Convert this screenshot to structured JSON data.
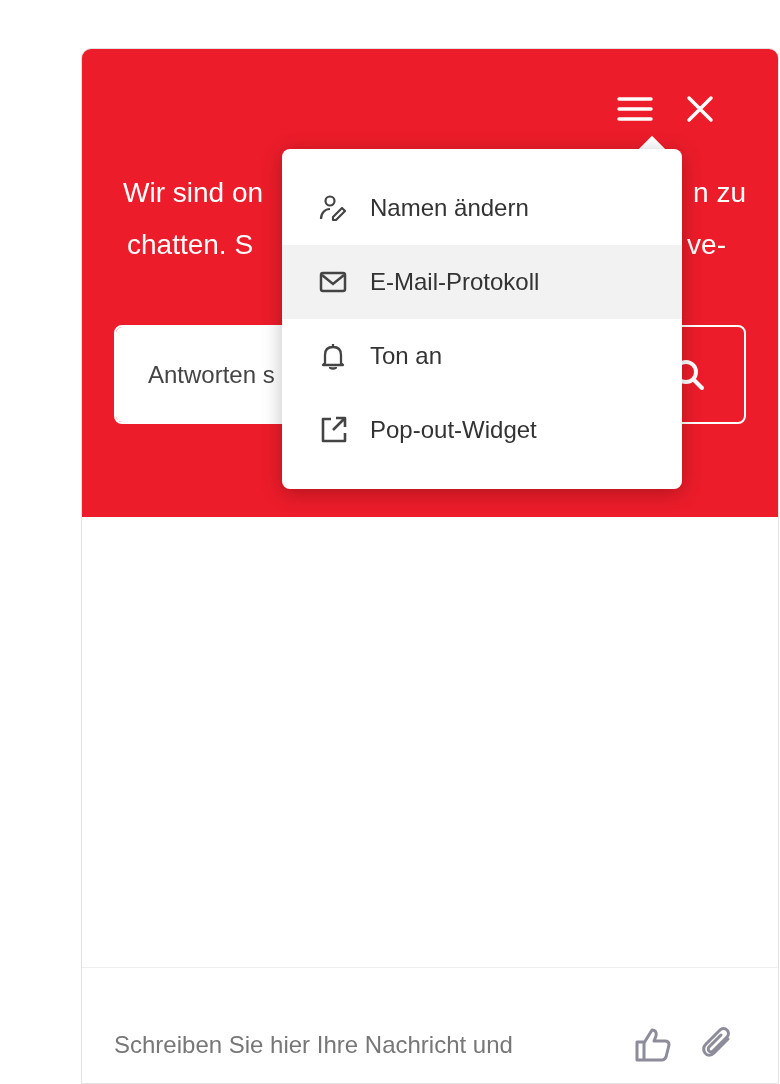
{
  "header": {
    "greeting_lines": [
      {
        "left": "Wir sind on",
        "right": "n zu"
      },
      {
        "left": "chatten. S",
        "right": "ve-"
      }
    ],
    "search": {
      "placeholder": "Antworten s"
    }
  },
  "menu": {
    "open": true,
    "items": [
      {
        "kind": "rename",
        "label": "Namen ändern",
        "selected": false
      },
      {
        "kind": "email",
        "label": "E-Mail-Protokoll",
        "selected": true
      },
      {
        "kind": "sound",
        "label": "Ton an",
        "selected": false
      },
      {
        "kind": "popout",
        "label": "Pop-out-Widget",
        "selected": false
      }
    ]
  },
  "composer": {
    "placeholder": "Schreiben Sie hier Ihre Nachricht und"
  }
}
